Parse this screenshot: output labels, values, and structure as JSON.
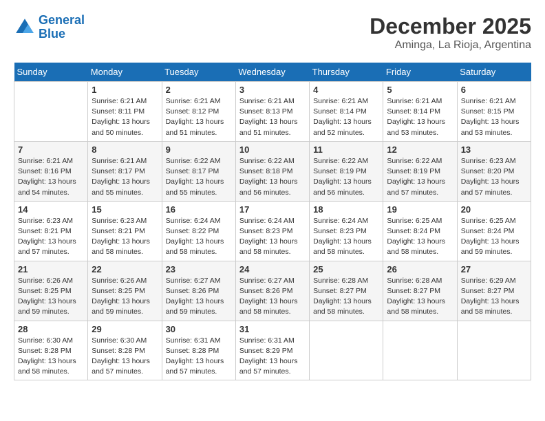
{
  "header": {
    "logo_line1": "General",
    "logo_line2": "Blue",
    "month": "December 2025",
    "location": "Aminga, La Rioja, Argentina"
  },
  "days_of_week": [
    "Sunday",
    "Monday",
    "Tuesday",
    "Wednesday",
    "Thursday",
    "Friday",
    "Saturday"
  ],
  "weeks": [
    [
      {
        "num": "",
        "sunrise": "",
        "sunset": "",
        "daylight": "",
        "empty": true
      },
      {
        "num": "1",
        "sunrise": "Sunrise: 6:21 AM",
        "sunset": "Sunset: 8:11 PM",
        "daylight": "Daylight: 13 hours and 50 minutes."
      },
      {
        "num": "2",
        "sunrise": "Sunrise: 6:21 AM",
        "sunset": "Sunset: 8:12 PM",
        "daylight": "Daylight: 13 hours and 51 minutes."
      },
      {
        "num": "3",
        "sunrise": "Sunrise: 6:21 AM",
        "sunset": "Sunset: 8:13 PM",
        "daylight": "Daylight: 13 hours and 51 minutes."
      },
      {
        "num": "4",
        "sunrise": "Sunrise: 6:21 AM",
        "sunset": "Sunset: 8:14 PM",
        "daylight": "Daylight: 13 hours and 52 minutes."
      },
      {
        "num": "5",
        "sunrise": "Sunrise: 6:21 AM",
        "sunset": "Sunset: 8:14 PM",
        "daylight": "Daylight: 13 hours and 53 minutes."
      },
      {
        "num": "6",
        "sunrise": "Sunrise: 6:21 AM",
        "sunset": "Sunset: 8:15 PM",
        "daylight": "Daylight: 13 hours and 53 minutes."
      }
    ],
    [
      {
        "num": "7",
        "sunrise": "Sunrise: 6:21 AM",
        "sunset": "Sunset: 8:16 PM",
        "daylight": "Daylight: 13 hours and 54 minutes."
      },
      {
        "num": "8",
        "sunrise": "Sunrise: 6:21 AM",
        "sunset": "Sunset: 8:17 PM",
        "daylight": "Daylight: 13 hours and 55 minutes."
      },
      {
        "num": "9",
        "sunrise": "Sunrise: 6:22 AM",
        "sunset": "Sunset: 8:17 PM",
        "daylight": "Daylight: 13 hours and 55 minutes."
      },
      {
        "num": "10",
        "sunrise": "Sunrise: 6:22 AM",
        "sunset": "Sunset: 8:18 PM",
        "daylight": "Daylight: 13 hours and 56 minutes."
      },
      {
        "num": "11",
        "sunrise": "Sunrise: 6:22 AM",
        "sunset": "Sunset: 8:19 PM",
        "daylight": "Daylight: 13 hours and 56 minutes."
      },
      {
        "num": "12",
        "sunrise": "Sunrise: 6:22 AM",
        "sunset": "Sunset: 8:19 PM",
        "daylight": "Daylight: 13 hours and 57 minutes."
      },
      {
        "num": "13",
        "sunrise": "Sunrise: 6:23 AM",
        "sunset": "Sunset: 8:20 PM",
        "daylight": "Daylight: 13 hours and 57 minutes."
      }
    ],
    [
      {
        "num": "14",
        "sunrise": "Sunrise: 6:23 AM",
        "sunset": "Sunset: 8:21 PM",
        "daylight": "Daylight: 13 hours and 57 minutes."
      },
      {
        "num": "15",
        "sunrise": "Sunrise: 6:23 AM",
        "sunset": "Sunset: 8:21 PM",
        "daylight": "Daylight: 13 hours and 58 minutes."
      },
      {
        "num": "16",
        "sunrise": "Sunrise: 6:24 AM",
        "sunset": "Sunset: 8:22 PM",
        "daylight": "Daylight: 13 hours and 58 minutes."
      },
      {
        "num": "17",
        "sunrise": "Sunrise: 6:24 AM",
        "sunset": "Sunset: 8:23 PM",
        "daylight": "Daylight: 13 hours and 58 minutes."
      },
      {
        "num": "18",
        "sunrise": "Sunrise: 6:24 AM",
        "sunset": "Sunset: 8:23 PM",
        "daylight": "Daylight: 13 hours and 58 minutes."
      },
      {
        "num": "19",
        "sunrise": "Sunrise: 6:25 AM",
        "sunset": "Sunset: 8:24 PM",
        "daylight": "Daylight: 13 hours and 58 minutes."
      },
      {
        "num": "20",
        "sunrise": "Sunrise: 6:25 AM",
        "sunset": "Sunset: 8:24 PM",
        "daylight": "Daylight: 13 hours and 59 minutes."
      }
    ],
    [
      {
        "num": "21",
        "sunrise": "Sunrise: 6:26 AM",
        "sunset": "Sunset: 8:25 PM",
        "daylight": "Daylight: 13 hours and 59 minutes."
      },
      {
        "num": "22",
        "sunrise": "Sunrise: 6:26 AM",
        "sunset": "Sunset: 8:25 PM",
        "daylight": "Daylight: 13 hours and 59 minutes."
      },
      {
        "num": "23",
        "sunrise": "Sunrise: 6:27 AM",
        "sunset": "Sunset: 8:26 PM",
        "daylight": "Daylight: 13 hours and 59 minutes."
      },
      {
        "num": "24",
        "sunrise": "Sunrise: 6:27 AM",
        "sunset": "Sunset: 8:26 PM",
        "daylight": "Daylight: 13 hours and 58 minutes."
      },
      {
        "num": "25",
        "sunrise": "Sunrise: 6:28 AM",
        "sunset": "Sunset: 8:27 PM",
        "daylight": "Daylight: 13 hours and 58 minutes."
      },
      {
        "num": "26",
        "sunrise": "Sunrise: 6:28 AM",
        "sunset": "Sunset: 8:27 PM",
        "daylight": "Daylight: 13 hours and 58 minutes."
      },
      {
        "num": "27",
        "sunrise": "Sunrise: 6:29 AM",
        "sunset": "Sunset: 8:27 PM",
        "daylight": "Daylight: 13 hours and 58 minutes."
      }
    ],
    [
      {
        "num": "28",
        "sunrise": "Sunrise: 6:30 AM",
        "sunset": "Sunset: 8:28 PM",
        "daylight": "Daylight: 13 hours and 58 minutes."
      },
      {
        "num": "29",
        "sunrise": "Sunrise: 6:30 AM",
        "sunset": "Sunset: 8:28 PM",
        "daylight": "Daylight: 13 hours and 57 minutes."
      },
      {
        "num": "30",
        "sunrise": "Sunrise: 6:31 AM",
        "sunset": "Sunset: 8:28 PM",
        "daylight": "Daylight: 13 hours and 57 minutes."
      },
      {
        "num": "31",
        "sunrise": "Sunrise: 6:31 AM",
        "sunset": "Sunset: 8:29 PM",
        "daylight": "Daylight: 13 hours and 57 minutes."
      },
      {
        "num": "",
        "sunrise": "",
        "sunset": "",
        "daylight": "",
        "empty": true
      },
      {
        "num": "",
        "sunrise": "",
        "sunset": "",
        "daylight": "",
        "empty": true
      },
      {
        "num": "",
        "sunrise": "",
        "sunset": "",
        "daylight": "",
        "empty": true
      }
    ]
  ]
}
